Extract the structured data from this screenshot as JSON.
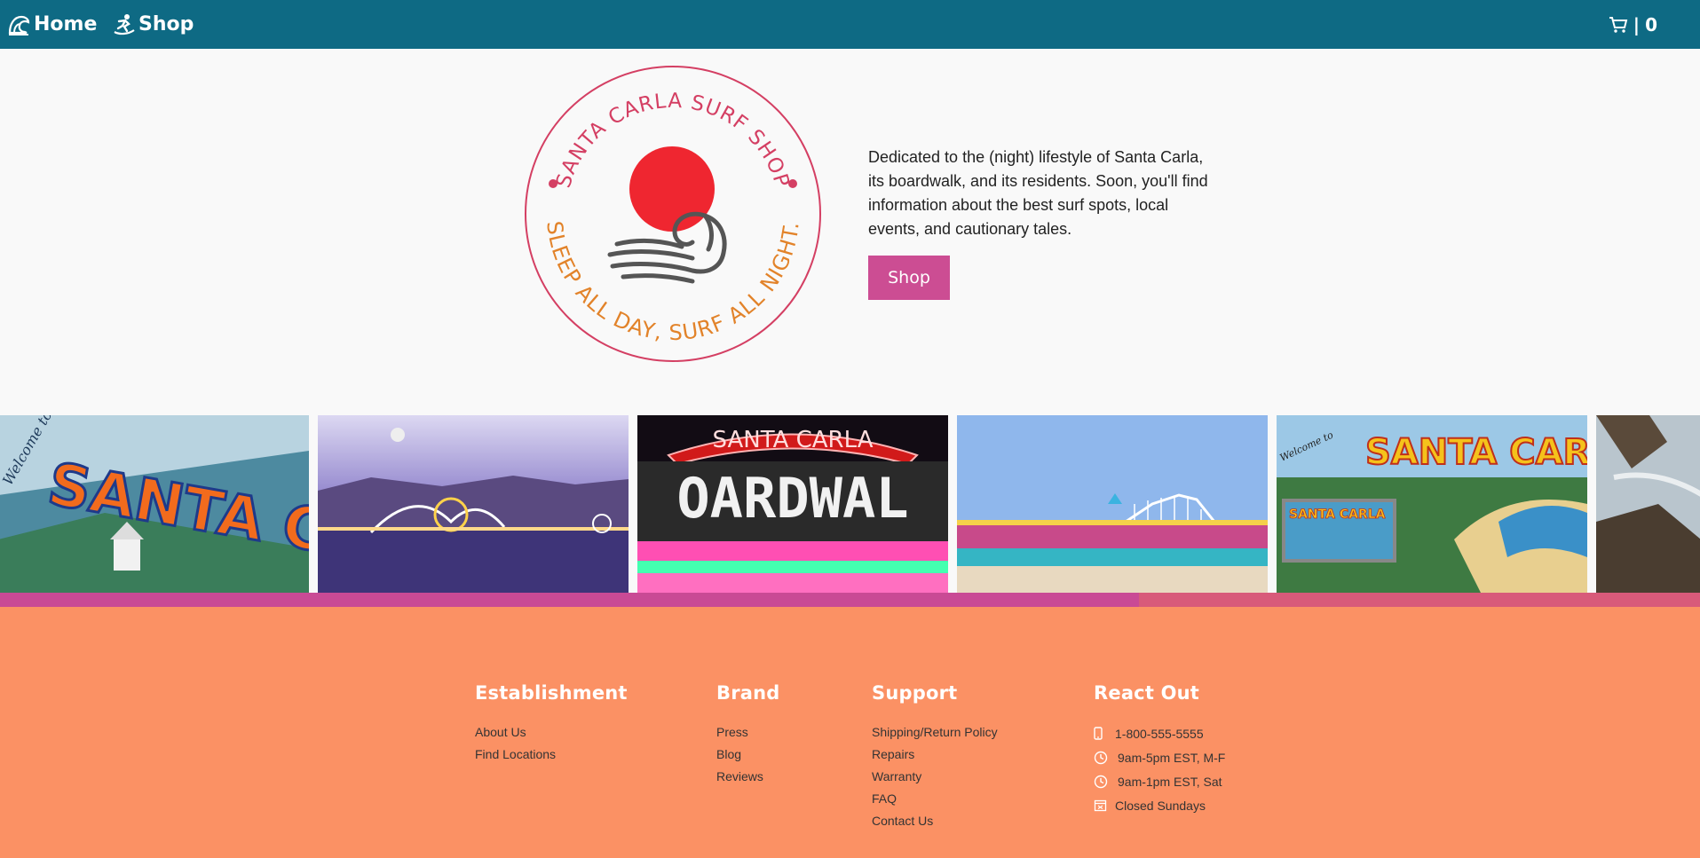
{
  "nav": {
    "home_label": "Home",
    "shop_label": "Shop",
    "cart_separator": "|",
    "cart_count": "0",
    "colors": {
      "background": "#0e6a84",
      "text": "#ffffff"
    },
    "icons": {
      "home": "wave-icon",
      "shop": "surfer-icon",
      "cart": "cart-icon"
    }
  },
  "hero": {
    "logo": {
      "top_text": "SANTA CARLA SURF SHOP",
      "bottom_text": "SLEEP ALL DAY, SURF ALL NIGHT."
    },
    "description": "Dedicated to the (night) lifestyle of Santa Carla, its boardwalk, and its residents. Soon, you'll find information about the best surf spots, local events, and cautionary tales.",
    "shop_button_label": "Shop",
    "colors": {
      "button": "#cc4d93",
      "logo_pink": "#d43f63",
      "logo_orange": "#e2832a",
      "sun": "#ef2630"
    }
  },
  "gallery": {
    "tiles": [
      {
        "name": "welcome-mural",
        "lettering": [
          "Welcome to",
          "SANTA CARLA"
        ]
      },
      {
        "name": "night-boardwalk",
        "lettering": []
      },
      {
        "name": "boardwalk-neon-sign",
        "lettering": [
          "SANTA CARLA",
          "OARDWAL"
        ]
      },
      {
        "name": "beach-boardwalk",
        "lettering": []
      },
      {
        "name": "welcome-postcard",
        "lettering": [
          "Welcome to",
          "SANTA CARLA",
          "SANTA CARLA"
        ]
      },
      {
        "name": "coast-cliffs",
        "lettering": []
      }
    ],
    "scroll_progress": 0.67,
    "colors": {
      "track": "#d85a7a",
      "fill": "#c94a95"
    }
  },
  "footer": {
    "background": "#fb9164",
    "columns": {
      "establishment": {
        "heading": "Establishment",
        "links": [
          "About Us",
          "Find Locations"
        ]
      },
      "brand": {
        "heading": "Brand",
        "links": [
          "Press",
          "Blog",
          "Reviews"
        ]
      },
      "support": {
        "heading": "Support",
        "links": [
          "Shipping/Return Policy",
          "Repairs",
          "Warranty",
          "FAQ",
          "Contact Us"
        ]
      },
      "reach": {
        "heading": "React Out",
        "items": [
          {
            "icon": "phone-icon",
            "text": "1-800-555-5555"
          },
          {
            "icon": "clock-icon",
            "text": "9am-5pm EST, M-F"
          },
          {
            "icon": "clock-icon",
            "text": "9am-1pm EST, Sat"
          },
          {
            "icon": "calendar-icon",
            "text": "Closed Sundays"
          }
        ]
      }
    }
  }
}
